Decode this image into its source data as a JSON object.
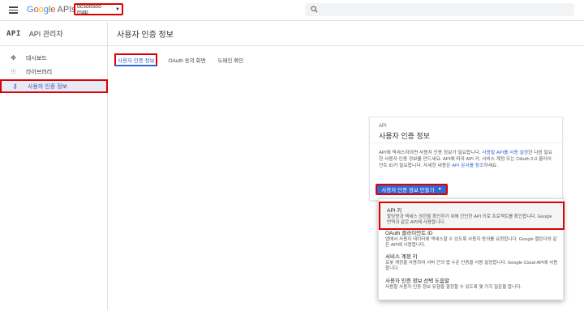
{
  "topbar": {
    "logo_letters": [
      "G",
      "o",
      "o",
      "g",
      "l",
      "e"
    ],
    "logo_suffix": "APIs",
    "project_name": "ocsoosoo map"
  },
  "sidebar": {
    "api_mark": "API",
    "title": "API 관리자",
    "items": [
      {
        "label": "대시보드",
        "icon": "dashboard-icon"
      },
      {
        "label": "라이브러리",
        "icon": "library-icon"
      },
      {
        "label": "사용자 인증 정보",
        "icon": "key-icon"
      }
    ]
  },
  "main": {
    "title": "사용자 인증 정보",
    "tabs": [
      "사용자 인증 정보",
      "OAuth 동의 화면",
      "도메인 확인"
    ]
  },
  "card": {
    "sup": "API",
    "title": "사용자 인증 정보",
    "body_1": "API에 액세스하려면 사용자 인증 정보가 필요합니다. ",
    "link_1": "사용할 API를 사용 설정",
    "body_2": "한 다음 필요한 사용자 인증 정보를 만드세요. API에 따라 API 키, 서비스 계정 또는 OAuth 2.0 클라이언트 ID가 필요합니다. 자세한 내용은 ",
    "link_2": "API 문서를 참조",
    "body_3": "하세요.",
    "create_button": "사용자 인증 정보 만들기"
  },
  "menu": {
    "items": [
      {
        "title": "API 키",
        "desc": "할당량과 액세스 권한을 확인하기 위해 간단한 API 키로 프로젝트를 확인합니다. Google 번역과 같은 API에 사용합니다."
      },
      {
        "title": "OAuth 클라이언트 ID",
        "desc": "앱에서 사용자 데이터에 액세스할 수 있도록 사용자 동의를 요청합니다. Google 캘린더와 같은 API에 사용합니다."
      },
      {
        "title": "서비스 계정 키",
        "desc": "로봇 계정을 사용하여 서버 간의 앱 수준 인증을 사용 설정합니다. Google Cloud API에 사용합니다."
      },
      {
        "title": "사용자 인증 정보 선택 도움말",
        "desc": "사용할 사용자 인증 정보 유형을 결정할 수 있도록 몇 가지 질문을 합니다."
      }
    ]
  },
  "colors": {
    "accent": "#3367d6",
    "highlight_border": "#dd0000",
    "active_bg": "#e8eaf6"
  }
}
